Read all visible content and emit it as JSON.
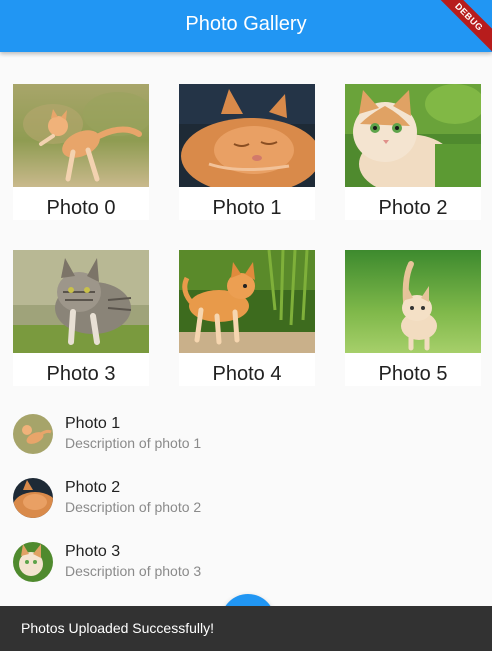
{
  "app_bar": {
    "title": "Photo Gallery",
    "background": "#2196f3",
    "debug_banner": "DEBUG"
  },
  "grid": {
    "items": [
      {
        "label": "Photo 0",
        "image": "kitten-jumping"
      },
      {
        "label": "Photo 1",
        "image": "cat-sleeping"
      },
      {
        "label": "Photo 2",
        "image": "kitten-in-grass"
      },
      {
        "label": "Photo 3",
        "image": "tabby-walking"
      },
      {
        "label": "Photo 4",
        "image": "orange-kitten-walking"
      },
      {
        "label": "Photo 5",
        "image": "kitten-in-meadow"
      }
    ]
  },
  "list": {
    "items": [
      {
        "title": "Photo 1",
        "subtitle": "Description of photo 1"
      },
      {
        "title": "Photo 2",
        "subtitle": "Description of photo 2"
      },
      {
        "title": "Photo 3",
        "subtitle": "Description of photo 3"
      }
    ]
  },
  "fab": {
    "icon": "add-icon",
    "color": "#2196f3"
  },
  "snackbar": {
    "message": "Photos Uploaded Successfully!"
  }
}
